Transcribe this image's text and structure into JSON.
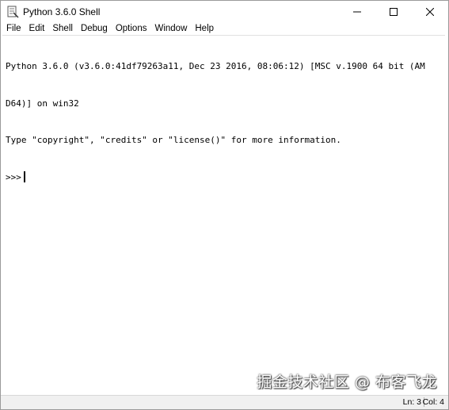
{
  "window": {
    "title": "Python 3.6.0 Shell",
    "controls": {
      "minimize": "—",
      "maximize": "☐",
      "close": "✕"
    }
  },
  "menubar": {
    "items": [
      {
        "label": "File"
      },
      {
        "label": "Edit"
      },
      {
        "label": "Shell"
      },
      {
        "label": "Debug"
      },
      {
        "label": "Options"
      },
      {
        "label": "Window"
      },
      {
        "label": "Help"
      }
    ]
  },
  "editor": {
    "lines": [
      "Python 3.6.0 (v3.6.0:41df79263a11, Dec 23 2016, 08:06:12) [MSC v.1900 64 bit (AM",
      "D64)] on win32",
      "Type \"copyright\", \"credits\" or \"license()\" for more information."
    ],
    "prompt": ">>>"
  },
  "statusbar": {
    "ln": "Ln: 3",
    "col": "Col: 4"
  },
  "watermark": "掘金技术社区 @ 布客飞龙",
  "icons": {
    "title": "python-idle-icon"
  }
}
